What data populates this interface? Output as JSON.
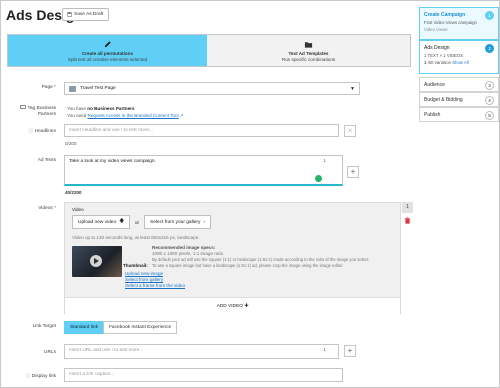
{
  "page": {
    "title": "Ads Design",
    "save_draft": "Save As Draft"
  },
  "permutations": {
    "create_all_title": "Create all permutations",
    "create_all_sub": "Split test all creative elements selected",
    "text_templates_title": "Text Ad Templates",
    "text_templates_sub": "Run specific combinations"
  },
  "form": {
    "page_label": "Page",
    "page_value": "Travel Test Page",
    "tag_partners_label": "Tag Business Partners",
    "tag_partners_line1_prefix": "You have ",
    "tag_partners_line1_bold": "no Business Partners",
    "tag_partners_line2_prefix": "You need ",
    "tag_partners_link": "Request Access in the Branded Content Tool",
    "headlines_label": "Headlines",
    "headlines_placeholder": "Insert Headline and use ! to test more...",
    "headlines_counter": "0/200",
    "adtexts_label": "Ad Texts",
    "adtexts_value": "Take a look at my video views campaign.",
    "adtexts_counter": "40/2200",
    "videos_label": "Videos",
    "video_section_title": "Video",
    "upload_new_video": "Upload new video",
    "or_text": "or",
    "select_gallery": "Select from your gallery",
    "video_hint": "Video up to 120 seconds long, at least 600x315 px, landscape.",
    "recommended_title": "Recommended image specs:",
    "recommended_line1": "1080 x 1080 pixels, 1:1 image ratio",
    "recommended_line2": "By default your ad will use the square (1:1) or landscape (1.91:1) mode according to the ratio of the image you select.",
    "recommended_line3": "To use a square image but have a landscape (1.91:1) ad, please crop the image using the image editor.",
    "thumbnail_label": "Thumbnail:",
    "thumb_upload": "Upload new image",
    "thumb_gallery": "Select from gallery",
    "thumb_frame": "Select a frame from the video",
    "add_video": "ADD VIDEO",
    "video_index": "1",
    "link_target_label": "Link Target",
    "link_standard": "Standard link",
    "link_instant": "Facebook Instant Experience",
    "urls_label": "URLs",
    "urls_placeholder": "Insert URL and use ! to test more...",
    "display_link_label": "Display link",
    "display_link_placeholder": "Insert a link caption...",
    "counter_1": "1"
  },
  "sidebar": {
    "steps": [
      {
        "title": "Create Campaign",
        "sub": "First Video Views campaign",
        "sub2": "Video Views",
        "num": "1"
      },
      {
        "title": "Ads Design",
        "sub": "1 TEXT × 1 VIDEOS",
        "sub2_prefix": "1",
        "sub2_text": " /50 variation ",
        "sub2_link": "Show All",
        "num": "2"
      },
      {
        "title": "Audience",
        "num": "3"
      },
      {
        "title": "Budget & Bidding",
        "num": "4"
      },
      {
        "title": "Publish",
        "num": "5"
      }
    ]
  },
  "colors": {
    "accent": "#5fcff6",
    "accent_dark": "#1d9fd8",
    "link": "#1a73c9"
  }
}
